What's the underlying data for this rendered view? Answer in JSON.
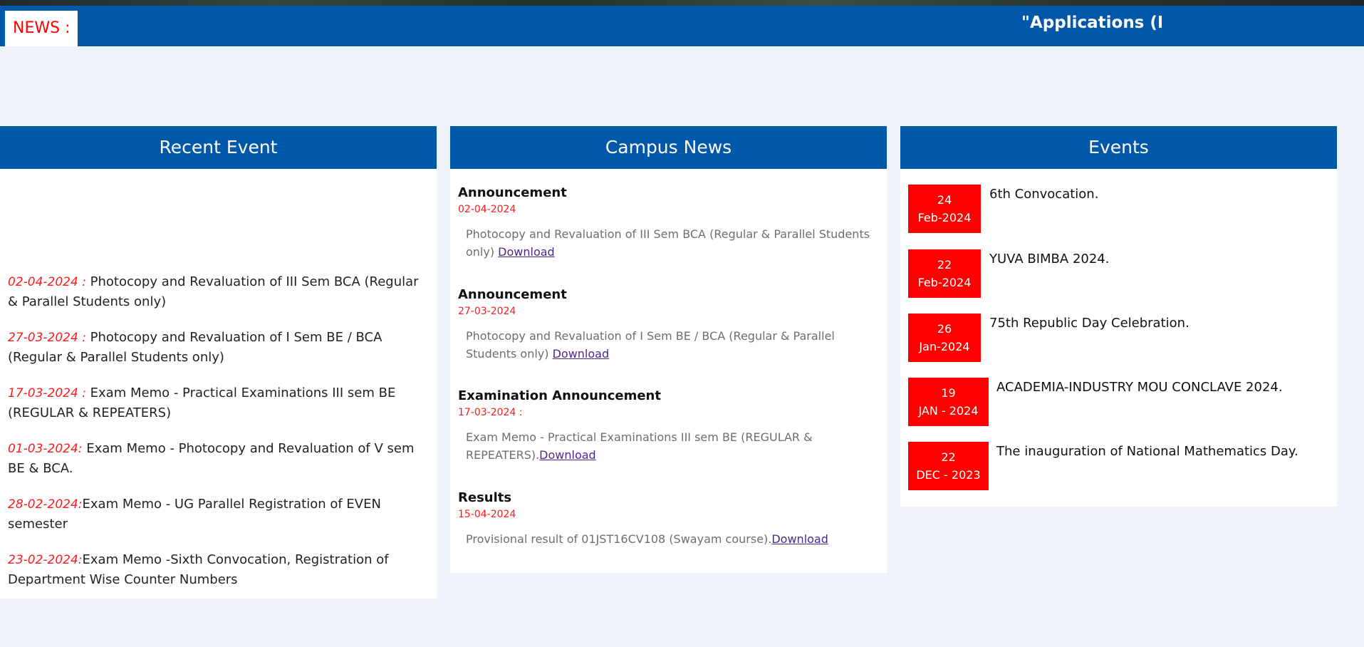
{
  "news_bar": {
    "label": "NEWS :",
    "ticker_text": "\"Applications (BCA"
  },
  "recent_event": {
    "heading": "Recent Event",
    "items": [
      {
        "date": "02-04-2024 :",
        "text": " Photocopy and Revaluation of III Sem BCA (Regular & Parallel Students only)"
      },
      {
        "date": "27-03-2024 :",
        "text": " Photocopy and Revaluation of I Sem BE / BCA (Regular & Parallel Students only)"
      },
      {
        "date": "17-03-2024 :",
        "text": " Exam Memo - Practical Examinations III sem BE (REGULAR & REPEATERS)"
      },
      {
        "date": "01-03-2024:",
        "text": " Exam Memo - Photocopy and Revaluation of V sem BE & BCA."
      },
      {
        "date": "28-02-2024:",
        "text": "Exam Memo - UG Parallel Registration of EVEN semester"
      },
      {
        "date": "23-02-2024:",
        "text": "Exam Memo -Sixth Convocation, Registration of Department Wise Counter Numbers"
      }
    ]
  },
  "campus_news": {
    "heading": "Campus News",
    "items": [
      {
        "title": "Announcement",
        "date": "02-04-2024",
        "text": "Photocopy and Revaluation of III Sem BCA (Regular & Parallel Students only) ",
        "link": "Download"
      },
      {
        "title": "Announcement",
        "date": "27-03-2024",
        "text": "Photocopy and Revaluation of I Sem BE / BCA (Regular & Parallel Students only) ",
        "link": "Download"
      },
      {
        "title": "Examination Announcement",
        "date": "17-03-2024 :",
        "text": "Exam Memo - Practical Examinations III sem BE (REGULAR & REPEATERS).",
        "link": "Download"
      },
      {
        "title": "Results",
        "date": "15-04-2024",
        "text": "Provisional result of 01JST16CV108 (Swayam course).",
        "link": "Download"
      }
    ]
  },
  "events": {
    "heading": "Events",
    "items": [
      {
        "day": "24",
        "month": "Feb-2024",
        "title": "6th Convocation."
      },
      {
        "day": "22",
        "month": "Feb-2024",
        "title": "YUVA BIMBA 2024."
      },
      {
        "day": "26",
        "month": "Jan-2024",
        "title": "75th Republic Day Celebration."
      },
      {
        "day": "19",
        "month": "JAN - 2024",
        "title": "ACADEMIA-INDUSTRY MOU CONCLAVE 2024."
      },
      {
        "day": "22",
        "month": "DEC - 2023",
        "title": "The inauguration of National Mathematics Day."
      }
    ]
  },
  "colors": {
    "primary_blue": "#0158a8",
    "accent_red": "#ff0000",
    "page_background": "#eef2f9",
    "link_purple": "#4b2a8a"
  }
}
